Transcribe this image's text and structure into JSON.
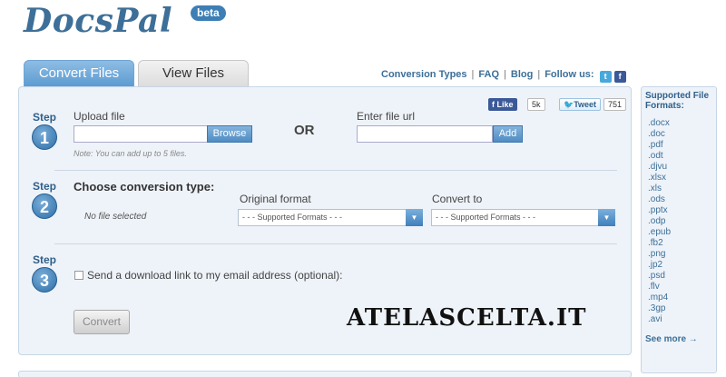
{
  "logo": {
    "text": "DocsPal",
    "badge": "beta"
  },
  "tabs": [
    {
      "label": "Convert Files"
    },
    {
      "label": "View Files"
    }
  ],
  "toplinks": {
    "conversion_types": "Conversion Types",
    "faq": "FAQ",
    "blog": "Blog",
    "follow_us": "Follow us:",
    "sep": "|"
  },
  "social": {
    "like_label": "Like",
    "like_count": "5k",
    "tweet_label": "Tweet",
    "tweet_count": "751"
  },
  "step1": {
    "step_word": "Step",
    "number": "1",
    "upload_label": "Upload file",
    "browse": "Browse",
    "note": "Note: You can add up to 5 files.",
    "or": "OR",
    "url_label": "Enter file url",
    "add": "Add"
  },
  "step2": {
    "step_word": "Step",
    "number": "2",
    "title": "Choose conversion type:",
    "no_file": "No file selected",
    "original_label": "Original format",
    "original_value": "- - - Supported Formats - - -",
    "convert_label": "Convert to",
    "convert_value": "- - - Supported Formats - - -"
  },
  "step3": {
    "step_word": "Step",
    "number": "3",
    "email_option": "Send a download link to my email address (optional):",
    "convert_button": "Convert"
  },
  "sidebar": {
    "title": "Supported File Formats:",
    "formats": [
      ".docx",
      ".doc",
      ".pdf",
      ".odt",
      ".djvu",
      ".xlsx",
      ".xls",
      ".ods",
      ".pptx",
      ".odp",
      ".epub",
      ".fb2",
      ".png",
      ".jp2",
      ".psd",
      ".flv",
      ".mp4",
      ".3gp",
      ".avi"
    ],
    "see_more": "See more →"
  },
  "watermark": "ATELASCELTA.IT",
  "colors": {
    "brand": "#3d6f98",
    "accent": "#5b9ad0",
    "panel": "#eef3f9"
  }
}
